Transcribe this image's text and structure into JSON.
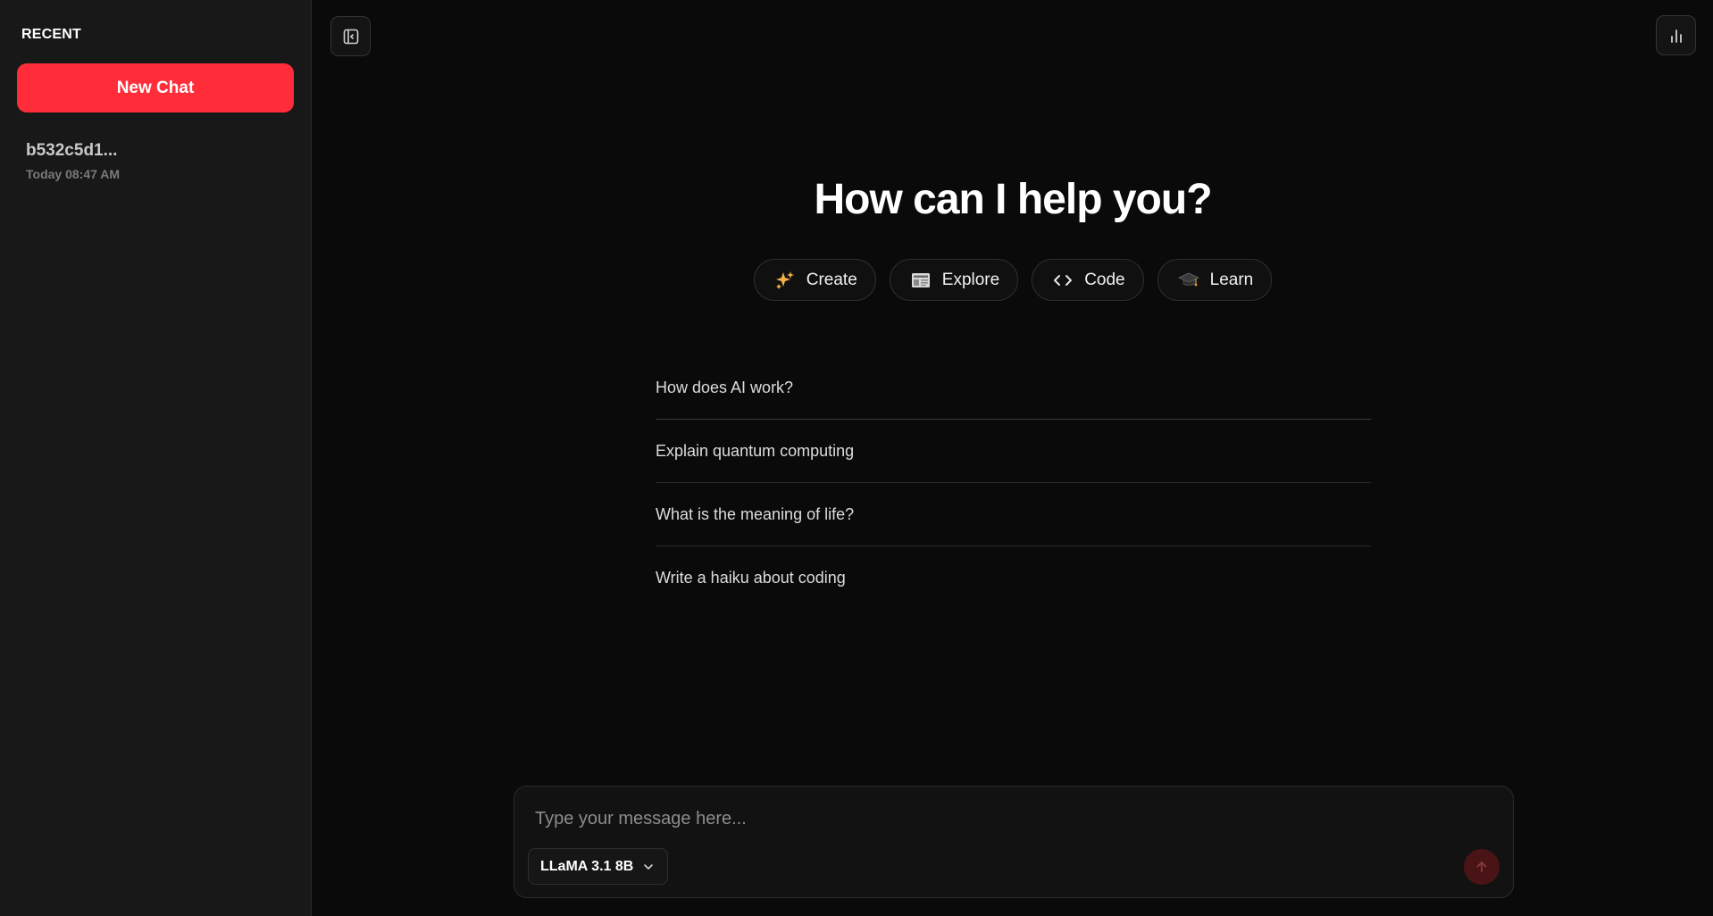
{
  "sidebar": {
    "heading": "RECENT",
    "new_chat_label": "New Chat",
    "chats": [
      {
        "title": "b532c5d1...",
        "time": "Today 08:47 AM"
      }
    ]
  },
  "main": {
    "heading": "How can I help you?",
    "categories": [
      {
        "label": "Create",
        "icon": "sparkles-icon"
      },
      {
        "label": "Explore",
        "icon": "newspaper-icon"
      },
      {
        "label": "Code",
        "icon": "code-brackets-icon"
      },
      {
        "label": "Learn",
        "icon": "graduation-cap-icon"
      }
    ],
    "suggestions": [
      "How does AI work?",
      "Explain quantum computing",
      "What is the meaning of life?",
      "Write a haiku about coding"
    ]
  },
  "composer": {
    "placeholder": "Type your message here...",
    "model": "LLaMA 3.1 8B"
  },
  "colors": {
    "accent": "#ff2d3a",
    "background": "#0a0a0a",
    "sidebar": "#181818",
    "send_disabled": "#4a1416"
  }
}
